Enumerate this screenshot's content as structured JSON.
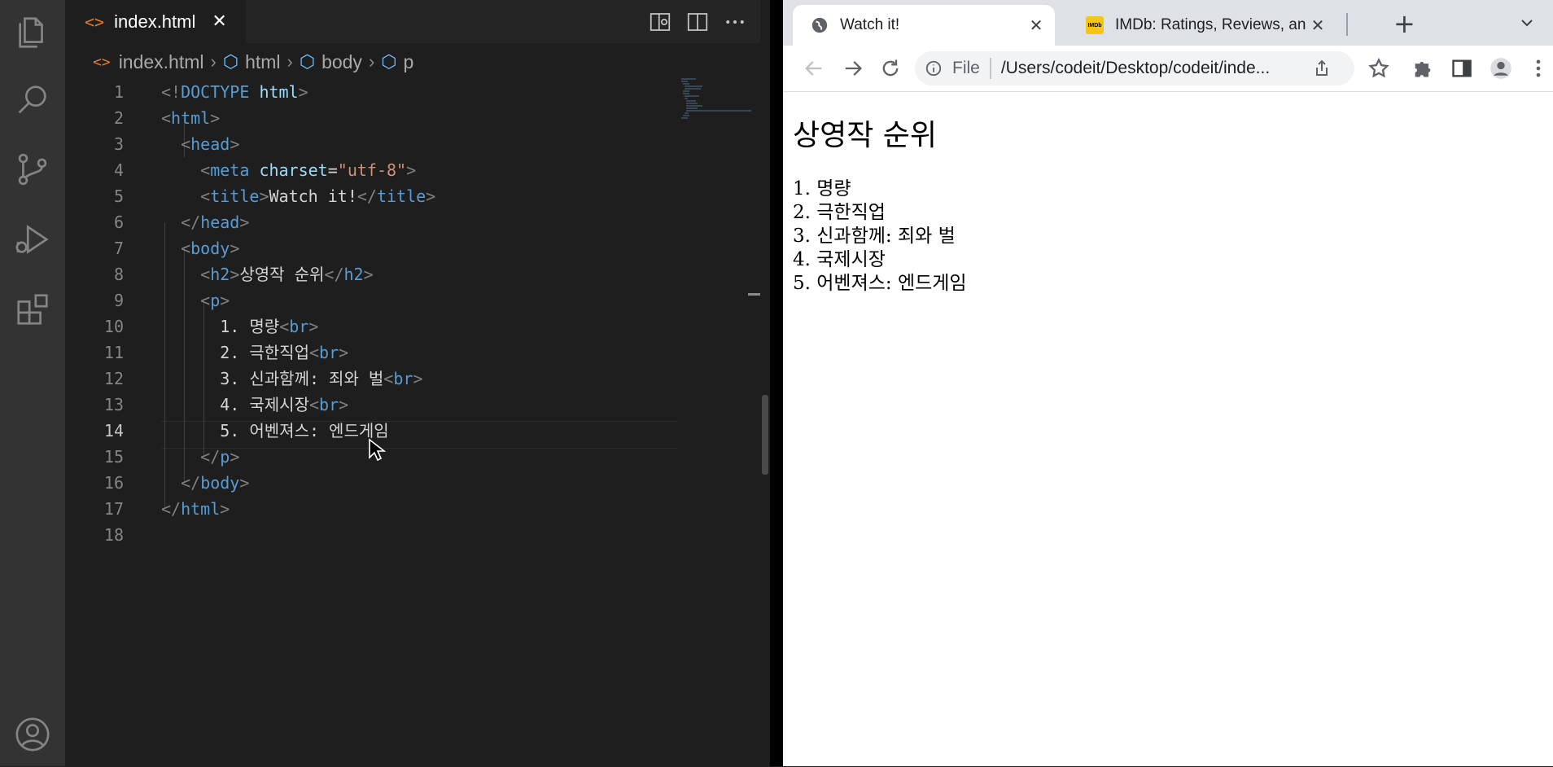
{
  "vscode": {
    "activity_icons": [
      "files-icon",
      "search-icon",
      "source-control-icon",
      "run-debug-icon",
      "extensions-icon",
      "account-icon"
    ],
    "tab": {
      "icon": "<>",
      "label": "index.html",
      "close": "✕"
    },
    "breadcrumbs": {
      "file": "index.html",
      "html": "html",
      "body": "body",
      "p": "p"
    },
    "lines": [
      {
        "n": "1"
      },
      {
        "n": "2"
      },
      {
        "n": "3"
      },
      {
        "n": "4"
      },
      {
        "n": "5"
      },
      {
        "n": "6"
      },
      {
        "n": "7"
      },
      {
        "n": "8"
      },
      {
        "n": "9"
      },
      {
        "n": "10"
      },
      {
        "n": "11"
      },
      {
        "n": "12"
      },
      {
        "n": "13"
      },
      {
        "n": "14"
      },
      {
        "n": "15"
      },
      {
        "n": "16"
      },
      {
        "n": "17"
      },
      {
        "n": "18"
      }
    ],
    "code": {
      "doctype_kw": "DOCTYPE",
      "doctype_html": "html",
      "html": "html",
      "head": "head",
      "meta": "meta",
      "charset_attr": "charset",
      "charset_val": "\"utf-8\"",
      "title": "title",
      "title_text": "Watch it!",
      "body": "body",
      "h2": "h2",
      "h2_text": "상영작 순위",
      "p": "p",
      "br": "br",
      "item1": "1. 명량",
      "item2": "2. 극한직업",
      "item3": "3. 신과함께: 죄와 벌",
      "item4": "4. 국제시장",
      "item5": "5. 어벤져스: 엔드게임"
    }
  },
  "browser": {
    "tabs": [
      {
        "title": "Watch it!",
        "favicon": "globe-icon"
      },
      {
        "title": "IMDb: Ratings, Reviews, and Where to Watch",
        "favicon": "imdb-icon",
        "favicon_text": "IMDb"
      }
    ],
    "close": "✕",
    "new_tab": "+",
    "address": {
      "scheme": "File",
      "url": "/Users/codeit/Desktop/codeit/inde..."
    },
    "page": {
      "heading": "상영작 순위",
      "items": [
        "1. 명량",
        "2. 극한직업",
        "3. 신과함께: 죄와 벌",
        "4. 국제시장",
        "5. 어벤져스: 엔드게임"
      ]
    },
    "accent": "#4285f4"
  },
  "colors": {
    "editor_bg": "#1e1e1e",
    "activity_bg": "#333333",
    "tag": "#569cd6",
    "attr": "#9cdcfe",
    "string": "#ce9178"
  }
}
